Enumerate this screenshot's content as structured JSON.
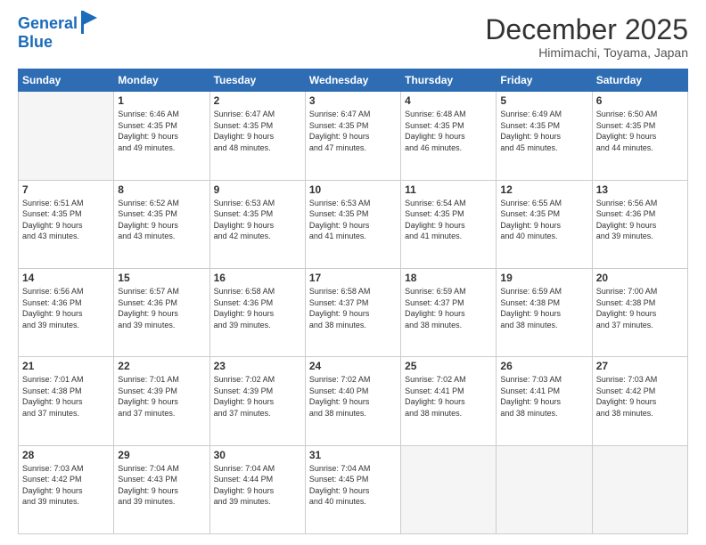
{
  "logo": {
    "line1": "General",
    "line2": "Blue"
  },
  "title": "December 2025",
  "subtitle": "Himimachi, Toyama, Japan",
  "days_header": [
    "Sunday",
    "Monday",
    "Tuesday",
    "Wednesday",
    "Thursday",
    "Friday",
    "Saturday"
  ],
  "weeks": [
    [
      {
        "day": "",
        "empty": true
      },
      {
        "day": "1",
        "sunrise": "6:46 AM",
        "sunset": "4:35 PM",
        "daylight": "9 hours and 49 minutes."
      },
      {
        "day": "2",
        "sunrise": "6:47 AM",
        "sunset": "4:35 PM",
        "daylight": "9 hours and 48 minutes."
      },
      {
        "day": "3",
        "sunrise": "6:47 AM",
        "sunset": "4:35 PM",
        "daylight": "9 hours and 47 minutes."
      },
      {
        "day": "4",
        "sunrise": "6:48 AM",
        "sunset": "4:35 PM",
        "daylight": "9 hours and 46 minutes."
      },
      {
        "day": "5",
        "sunrise": "6:49 AM",
        "sunset": "4:35 PM",
        "daylight": "9 hours and 45 minutes."
      },
      {
        "day": "6",
        "sunrise": "6:50 AM",
        "sunset": "4:35 PM",
        "daylight": "9 hours and 44 minutes."
      }
    ],
    [
      {
        "day": "7",
        "sunrise": "6:51 AM",
        "sunset": "4:35 PM",
        "daylight": "9 hours and 43 minutes."
      },
      {
        "day": "8",
        "sunrise": "6:52 AM",
        "sunset": "4:35 PM",
        "daylight": "9 hours and 43 minutes."
      },
      {
        "day": "9",
        "sunrise": "6:53 AM",
        "sunset": "4:35 PM",
        "daylight": "9 hours and 42 minutes."
      },
      {
        "day": "10",
        "sunrise": "6:53 AM",
        "sunset": "4:35 PM",
        "daylight": "9 hours and 41 minutes."
      },
      {
        "day": "11",
        "sunrise": "6:54 AM",
        "sunset": "4:35 PM",
        "daylight": "9 hours and 41 minutes."
      },
      {
        "day": "12",
        "sunrise": "6:55 AM",
        "sunset": "4:35 PM",
        "daylight": "9 hours and 40 minutes."
      },
      {
        "day": "13",
        "sunrise": "6:56 AM",
        "sunset": "4:36 PM",
        "daylight": "9 hours and 39 minutes."
      }
    ],
    [
      {
        "day": "14",
        "sunrise": "6:56 AM",
        "sunset": "4:36 PM",
        "daylight": "9 hours and 39 minutes."
      },
      {
        "day": "15",
        "sunrise": "6:57 AM",
        "sunset": "4:36 PM",
        "daylight": "9 hours and 39 minutes."
      },
      {
        "day": "16",
        "sunrise": "6:58 AM",
        "sunset": "4:36 PM",
        "daylight": "9 hours and 39 minutes."
      },
      {
        "day": "17",
        "sunrise": "6:58 AM",
        "sunset": "4:37 PM",
        "daylight": "9 hours and 38 minutes."
      },
      {
        "day": "18",
        "sunrise": "6:59 AM",
        "sunset": "4:37 PM",
        "daylight": "9 hours and 38 minutes."
      },
      {
        "day": "19",
        "sunrise": "6:59 AM",
        "sunset": "4:38 PM",
        "daylight": "9 hours and 38 minutes."
      },
      {
        "day": "20",
        "sunrise": "7:00 AM",
        "sunset": "4:38 PM",
        "daylight": "9 hours and 37 minutes."
      }
    ],
    [
      {
        "day": "21",
        "sunrise": "7:01 AM",
        "sunset": "4:38 PM",
        "daylight": "9 hours and 37 minutes."
      },
      {
        "day": "22",
        "sunrise": "7:01 AM",
        "sunset": "4:39 PM",
        "daylight": "9 hours and 37 minutes."
      },
      {
        "day": "23",
        "sunrise": "7:02 AM",
        "sunset": "4:39 PM",
        "daylight": "9 hours and 37 minutes."
      },
      {
        "day": "24",
        "sunrise": "7:02 AM",
        "sunset": "4:40 PM",
        "daylight": "9 hours and 38 minutes."
      },
      {
        "day": "25",
        "sunrise": "7:02 AM",
        "sunset": "4:41 PM",
        "daylight": "9 hours and 38 minutes."
      },
      {
        "day": "26",
        "sunrise": "7:03 AM",
        "sunset": "4:41 PM",
        "daylight": "9 hours and 38 minutes."
      },
      {
        "day": "27",
        "sunrise": "7:03 AM",
        "sunset": "4:42 PM",
        "daylight": "9 hours and 38 minutes."
      }
    ],
    [
      {
        "day": "28",
        "sunrise": "7:03 AM",
        "sunset": "4:42 PM",
        "daylight": "9 hours and 39 minutes."
      },
      {
        "day": "29",
        "sunrise": "7:04 AM",
        "sunset": "4:43 PM",
        "daylight": "9 hours and 39 minutes."
      },
      {
        "day": "30",
        "sunrise": "7:04 AM",
        "sunset": "4:44 PM",
        "daylight": "9 hours and 39 minutes."
      },
      {
        "day": "31",
        "sunrise": "7:04 AM",
        "sunset": "4:45 PM",
        "daylight": "9 hours and 40 minutes."
      },
      {
        "day": "",
        "empty": true
      },
      {
        "day": "",
        "empty": true
      },
      {
        "day": "",
        "empty": true
      }
    ]
  ]
}
